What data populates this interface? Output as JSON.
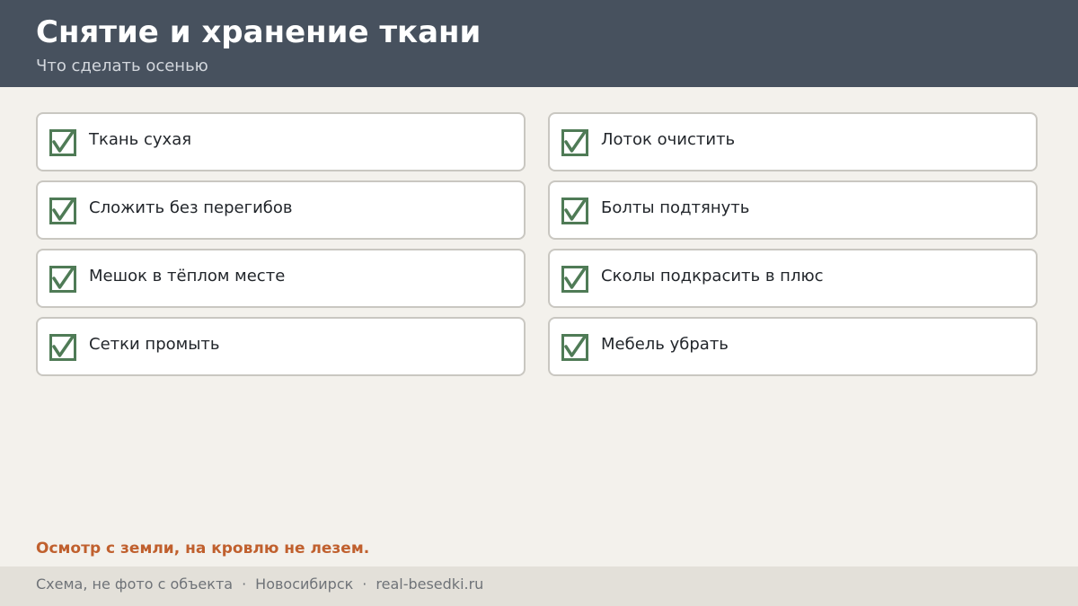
{
  "header": {
    "title": "Снятие и хранение ткани",
    "subtitle": "Что сделать осенью"
  },
  "checklist": {
    "check_color": "#4f7b56",
    "items": [
      {
        "label": "Ткань сухая",
        "checked": true
      },
      {
        "label": "Лоток очистить",
        "checked": true
      },
      {
        "label": "Сложить без перегибов",
        "checked": true
      },
      {
        "label": "Болты подтянуть",
        "checked": true
      },
      {
        "label": "Мешок в тёплом месте",
        "checked": true
      },
      {
        "label": "Сколы подкрасить в плюс",
        "checked": true
      },
      {
        "label": "Сетки промыть",
        "checked": true
      },
      {
        "label": "Мебель убрать",
        "checked": true
      }
    ]
  },
  "note": {
    "text": "Осмотр с земли, на кровлю не лезем.",
    "color": "#c0602e"
  },
  "footer": {
    "parts": [
      "Схема, не фото с объекта",
      "Новосибирск",
      "real-besedki.ru"
    ],
    "separator": "·"
  },
  "colors": {
    "header_bg": "#47515e",
    "page_bg": "#f3f1ec",
    "footer_bg": "#e3e0d9"
  }
}
